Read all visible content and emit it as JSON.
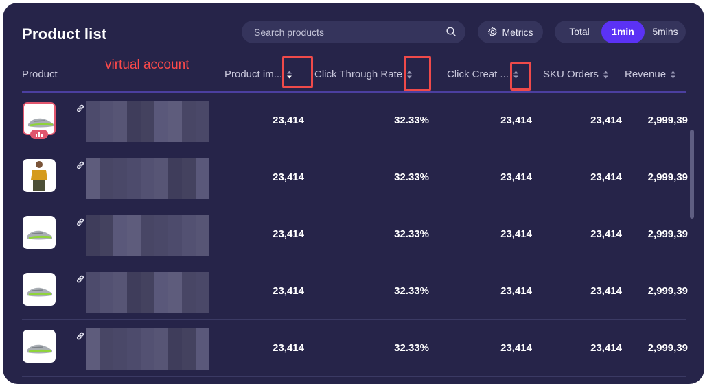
{
  "title": "Product list",
  "search": {
    "placeholder": "Search products"
  },
  "metrics_label": "Metrics",
  "time_toggle": [
    "Total",
    "1min",
    "5mins"
  ],
  "time_toggle_active": "1min",
  "annotation": "virtual account",
  "columns": [
    "Product",
    "Product im...",
    "Click Through Rate",
    "Click Creat ...",
    "SKU Orders",
    "Revenue"
  ],
  "rows": [
    {
      "product_image": "sneaker",
      "selected": true,
      "impressions": "23,414",
      "ctr": "32.33%",
      "ccr": "23,414",
      "sku_orders": "23,414",
      "revenue": "2,999,39"
    },
    {
      "product_image": "person-yellow-shirt",
      "selected": false,
      "impressions": "23,414",
      "ctr": "32.33%",
      "ccr": "23,414",
      "sku_orders": "23,414",
      "revenue": "2,999,39"
    },
    {
      "product_image": "sneaker",
      "selected": false,
      "impressions": "23,414",
      "ctr": "32.33%",
      "ccr": "23,414",
      "sku_orders": "23,414",
      "revenue": "2,999,39"
    },
    {
      "product_image": "sneaker",
      "selected": false,
      "impressions": "23,414",
      "ctr": "32.33%",
      "ccr": "23,414",
      "sku_orders": "23,414",
      "revenue": "2,999,39"
    },
    {
      "product_image": "sneaker",
      "selected": false,
      "impressions": "23,414",
      "ctr": "32.33%",
      "ccr": "23,414",
      "sku_orders": "23,414",
      "revenue": "2,999,39"
    }
  ],
  "colors": {
    "panel": "#262449",
    "accent": "#5b32f5",
    "highlight": "#ef4a4a",
    "badge": "#e0566e"
  }
}
